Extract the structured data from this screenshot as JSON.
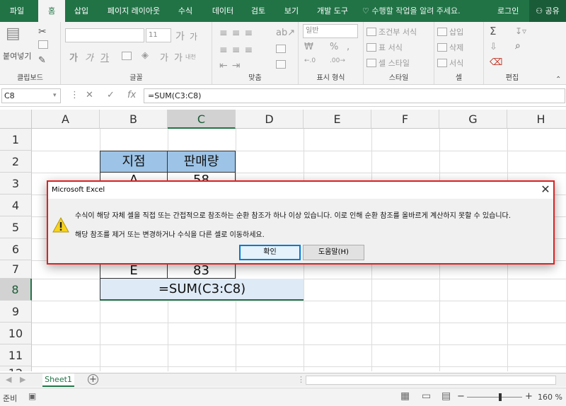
{
  "ribbon_tabs": [
    "파일",
    "홈",
    "삽입",
    "페이지 레이아웃",
    "수식",
    "데이터",
    "검토",
    "보기",
    "개발 도구"
  ],
  "active_tab": "홈",
  "tell_me": "수행할 작업을 알려 주세요.",
  "login": "로그인",
  "share": "공유",
  "ribbon": {
    "clipboard": {
      "paste": "붙여넣기",
      "label": "클립보드"
    },
    "font": {
      "label": "글꼴",
      "size": "11",
      "grow": "가",
      "shrink": "가",
      "bold": "가",
      "italic": "가",
      "underline": "가",
      "phonetic": "가",
      "phonetic_sub": "내천"
    },
    "alignment": {
      "label": "맞춤"
    },
    "number": {
      "label": "표시 형식",
      "format": "일반"
    },
    "styles": {
      "label": "스타일",
      "conditional": "조건부 서식",
      "table": "표 서식",
      "cell": "셀 스타일"
    },
    "cells": {
      "label": "셀",
      "insert": "삽입",
      "delete": "삭제",
      "format": "서식"
    },
    "editing": {
      "label": "편집"
    }
  },
  "formula_bar": {
    "name_box": "C8",
    "cancel": "✕",
    "enter": "✓",
    "fx": "fx",
    "formula": "=SUM(C3:C8)"
  },
  "columns": [
    "A",
    "B",
    "C",
    "D",
    "E",
    "F",
    "G",
    "H"
  ],
  "rows": [
    "1",
    "2",
    "3",
    "4",
    "5",
    "6",
    "7",
    "8",
    "9",
    "10",
    "11",
    "12"
  ],
  "selected_column": "C",
  "selected_row": "8",
  "cells": {
    "header_b": "지점",
    "header_c": "판매량",
    "b3": "A",
    "c3": "58",
    "b7": "E",
    "c7": "83",
    "b8": "=SUM(C3:C8)"
  },
  "sheet_tab": "Sheet1",
  "status": {
    "ready": "준비",
    "zoom": "160 %",
    "minus": "−",
    "plus": "+"
  },
  "dialog": {
    "title": "Microsoft Excel",
    "close": "✕",
    "message1": "수식이 해당 자체 셀을 직접 또는 간접적으로 참조하는 순환 참조가 하나 이상 있습니다. 이로 인해 순환 참조를 올바르게 계산하지 못할 수 있습니다.",
    "message2": "해당 참조를 제거 또는 변경하거나 수식을 다른 셀로 이동하세요.",
    "ok": "확인",
    "help": "도움말(H)"
  }
}
